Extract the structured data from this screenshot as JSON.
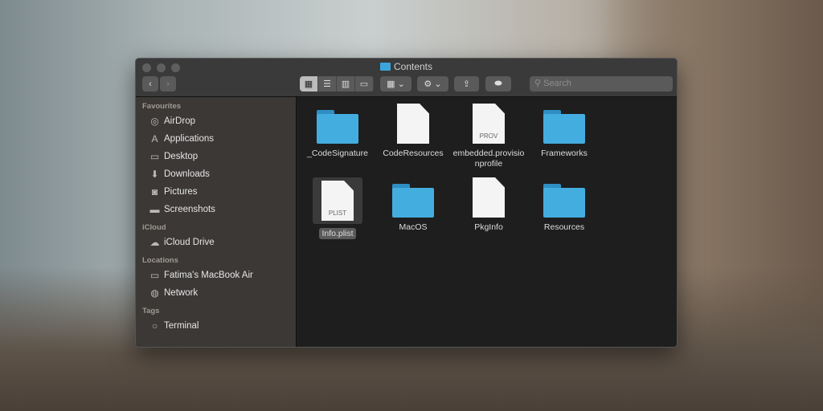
{
  "window": {
    "title": "Contents"
  },
  "toolbar": {
    "back": "‹",
    "forward": "›",
    "views": [
      "▦",
      "☰",
      "▥",
      "▭"
    ],
    "group": "▦ ⌄",
    "action": "⚙ ⌄",
    "share": "⇪",
    "tag": "⬬",
    "search_placeholder": "Search"
  },
  "sidebar": {
    "favourites_header": "Favourites",
    "favourites": [
      {
        "label": "AirDrop",
        "icon": "◎"
      },
      {
        "label": "Applications",
        "icon": "A"
      },
      {
        "label": "Desktop",
        "icon": "▭"
      },
      {
        "label": "Downloads",
        "icon": "⬇"
      },
      {
        "label": "Pictures",
        "icon": "◙"
      },
      {
        "label": "Screenshots",
        "icon": "▬"
      }
    ],
    "icloud_header": "iCloud",
    "icloud": [
      {
        "label": "iCloud Drive",
        "icon": "☁"
      }
    ],
    "locations_header": "Locations",
    "locations": [
      {
        "label": "Fatima's MacBook Air",
        "icon": "▭"
      },
      {
        "label": "Network",
        "icon": "◍"
      }
    ],
    "tags_header": "Tags",
    "tags": [
      {
        "label": "Terminal",
        "icon": "○"
      }
    ]
  },
  "files": [
    {
      "name": "_CodeSignature",
      "kind": "folder"
    },
    {
      "name": "CodeResources",
      "kind": "doc",
      "badge": ""
    },
    {
      "name": "embedded.provisionprofile",
      "kind": "doc",
      "badge": "PROV"
    },
    {
      "name": "Frameworks",
      "kind": "folder"
    },
    {
      "name": "Info.plist",
      "kind": "doc",
      "badge": "PLIST",
      "selected": true
    },
    {
      "name": "MacOS",
      "kind": "folder"
    },
    {
      "name": "PkgInfo",
      "kind": "doc",
      "badge": ""
    },
    {
      "name": "Resources",
      "kind": "folder"
    }
  ]
}
